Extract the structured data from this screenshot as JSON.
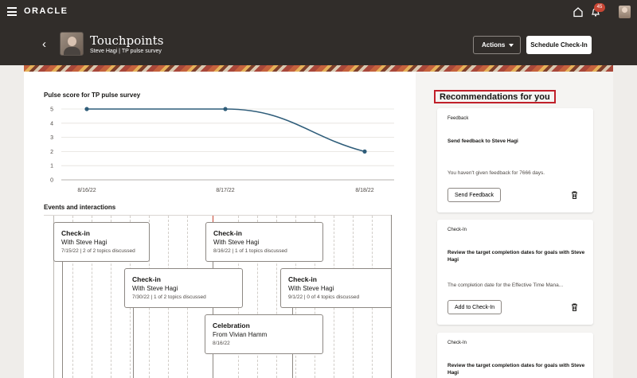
{
  "topbar": {
    "logo": "ORACLE",
    "notification_count": "45"
  },
  "header": {
    "title": "Touchpoints",
    "subtitle": "Steve Hagi | TP pulse survey",
    "actions_label": "Actions",
    "schedule_label": "Schedule Check-In"
  },
  "pulse": {
    "title": "Pulse score for TP pulse survey",
    "chart_data": {
      "type": "line",
      "categories": [
        "8/16/22",
        "8/17/22",
        "8/18/22"
      ],
      "values": [
        5,
        5,
        2
      ],
      "ylim": [
        0,
        5
      ],
      "yticks": [
        "0",
        "1",
        "2",
        "3",
        "4",
        "5"
      ],
      "grid": true,
      "color": "#2f5d7a"
    }
  },
  "events": {
    "title": "Events and interactions",
    "items": [
      {
        "type": "Check-in",
        "with": "With Steve Hagi",
        "detail": "7/15/22 | 2 of 2 topics discussed"
      },
      {
        "type": "Check-in",
        "with": "With Steve Hagi",
        "detail": "8/16/22 | 1 of 1 topics discussed"
      },
      {
        "type": "Check-in",
        "with": "With Steve Hagi",
        "detail": "7/30/22 | 1 of 2 topics discussed"
      },
      {
        "type": "Check-in",
        "with": "With Steve Hagi",
        "detail": "9/1/22 | 0 of 4 topics discussed"
      },
      {
        "type": "Celebration",
        "with": "From Vivian Hamm",
        "detail": "8/16/22"
      }
    ]
  },
  "recommendations": {
    "title": "Recommendations for you",
    "cards": [
      {
        "category": "Feedback",
        "heading": "Send feedback to Steve Hagi",
        "description": "You haven't given feedback for 7666 days.",
        "action": "Send Feedback"
      },
      {
        "category": "Check-In",
        "heading": "Review the target completion dates for goals with Steve Hagi",
        "description": "The completion date for the Effective Time Mana...",
        "action": "Add to Check-In"
      },
      {
        "category": "Check-In",
        "heading": "Review the target completion dates for goals with Steve Hagi"
      }
    ]
  }
}
